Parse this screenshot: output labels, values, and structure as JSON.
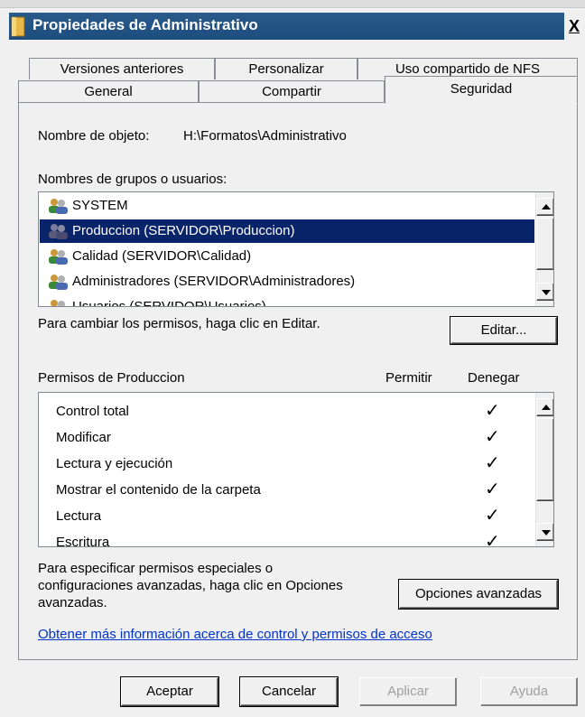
{
  "window": {
    "title": "Propiedades de Administrativo",
    "close": "X"
  },
  "tabs": {
    "row1": [
      "Versiones anteriores",
      "Personalizar",
      "Uso compartido de NFS"
    ],
    "row2": [
      "General",
      "Compartir",
      "Seguridad"
    ],
    "active": "Seguridad"
  },
  "object": {
    "label": "Nombre de objeto:",
    "value": "H:\\Formatos\\Administrativo"
  },
  "groups": {
    "label": "Nombres de grupos o usuarios:",
    "items": [
      "SYSTEM",
      "Produccion (SERVIDOR\\Produccion)",
      "Calidad (SERVIDOR\\Calidad)",
      "Administradores (SERVIDOR\\Administradores)",
      "Usuarios (SERVIDOR\\Usuarios)"
    ],
    "selected_index": 1
  },
  "edit": {
    "hint": "Para cambiar los permisos, haga clic en Editar.",
    "button": "Editar..."
  },
  "permissions": {
    "title": "Permisos de Produccion",
    "col_allow": "Permitir",
    "col_deny": "Denegar",
    "rows": [
      {
        "name": "Control total",
        "deny": "✓"
      },
      {
        "name": "Modificar",
        "deny": "✓"
      },
      {
        "name": "Lectura y ejecución",
        "deny": "✓"
      },
      {
        "name": "Mostrar el contenido de la carpeta",
        "deny": "✓"
      },
      {
        "name": "Lectura",
        "deny": "✓"
      },
      {
        "name": "Escritura",
        "deny": "✓"
      }
    ]
  },
  "advanced": {
    "hint_line1": "Para especificar permisos especiales o",
    "hint_line2": "configuraciones avanzadas, haga clic en Opciones",
    "hint_line3": "avanzadas.",
    "button": "Opciones avanzadas"
  },
  "link": "Obtener más información acerca de control y permisos de acceso",
  "footer": {
    "ok": "Aceptar",
    "cancel": "Cancelar",
    "apply": "Aplicar",
    "help": "Ayuda"
  },
  "colors": {
    "title_bar": "#1c4d7e",
    "selection": "#0a246a",
    "link": "#0033cc"
  }
}
